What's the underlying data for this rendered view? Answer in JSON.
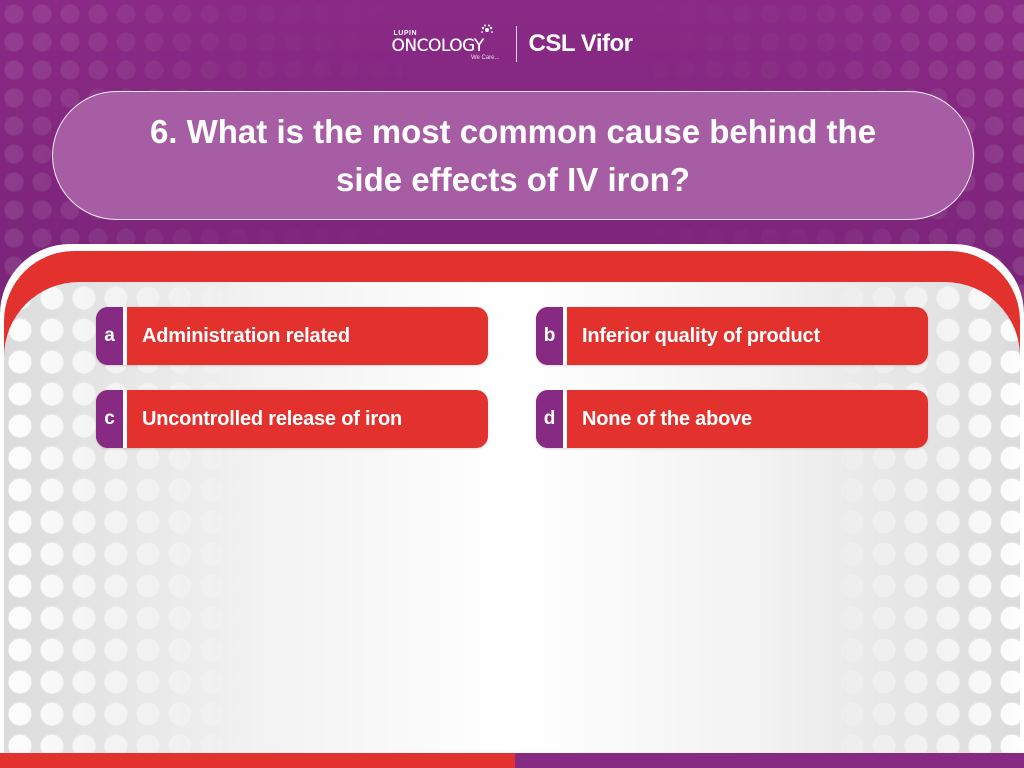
{
  "header": {
    "lupin_small": "LUPIN",
    "lupin_name": "ONCOLOGY",
    "lupin_tagline": "We Care...",
    "partner_name": "CSL Vifor"
  },
  "question": {
    "text": "6. What is the most common cause behind the side effects of IV iron?"
  },
  "options": [
    {
      "letter": "a",
      "label": "Administration related"
    },
    {
      "letter": "b",
      "label": "Inferior quality of product"
    },
    {
      "letter": "c",
      "label": "Uncontrolled release of iron"
    },
    {
      "letter": "d",
      "label": "None of the above"
    }
  ],
  "colors": {
    "brand_purple": "#862a83",
    "pill_purple": "#a75da4",
    "accent_red": "#e3312e"
  }
}
